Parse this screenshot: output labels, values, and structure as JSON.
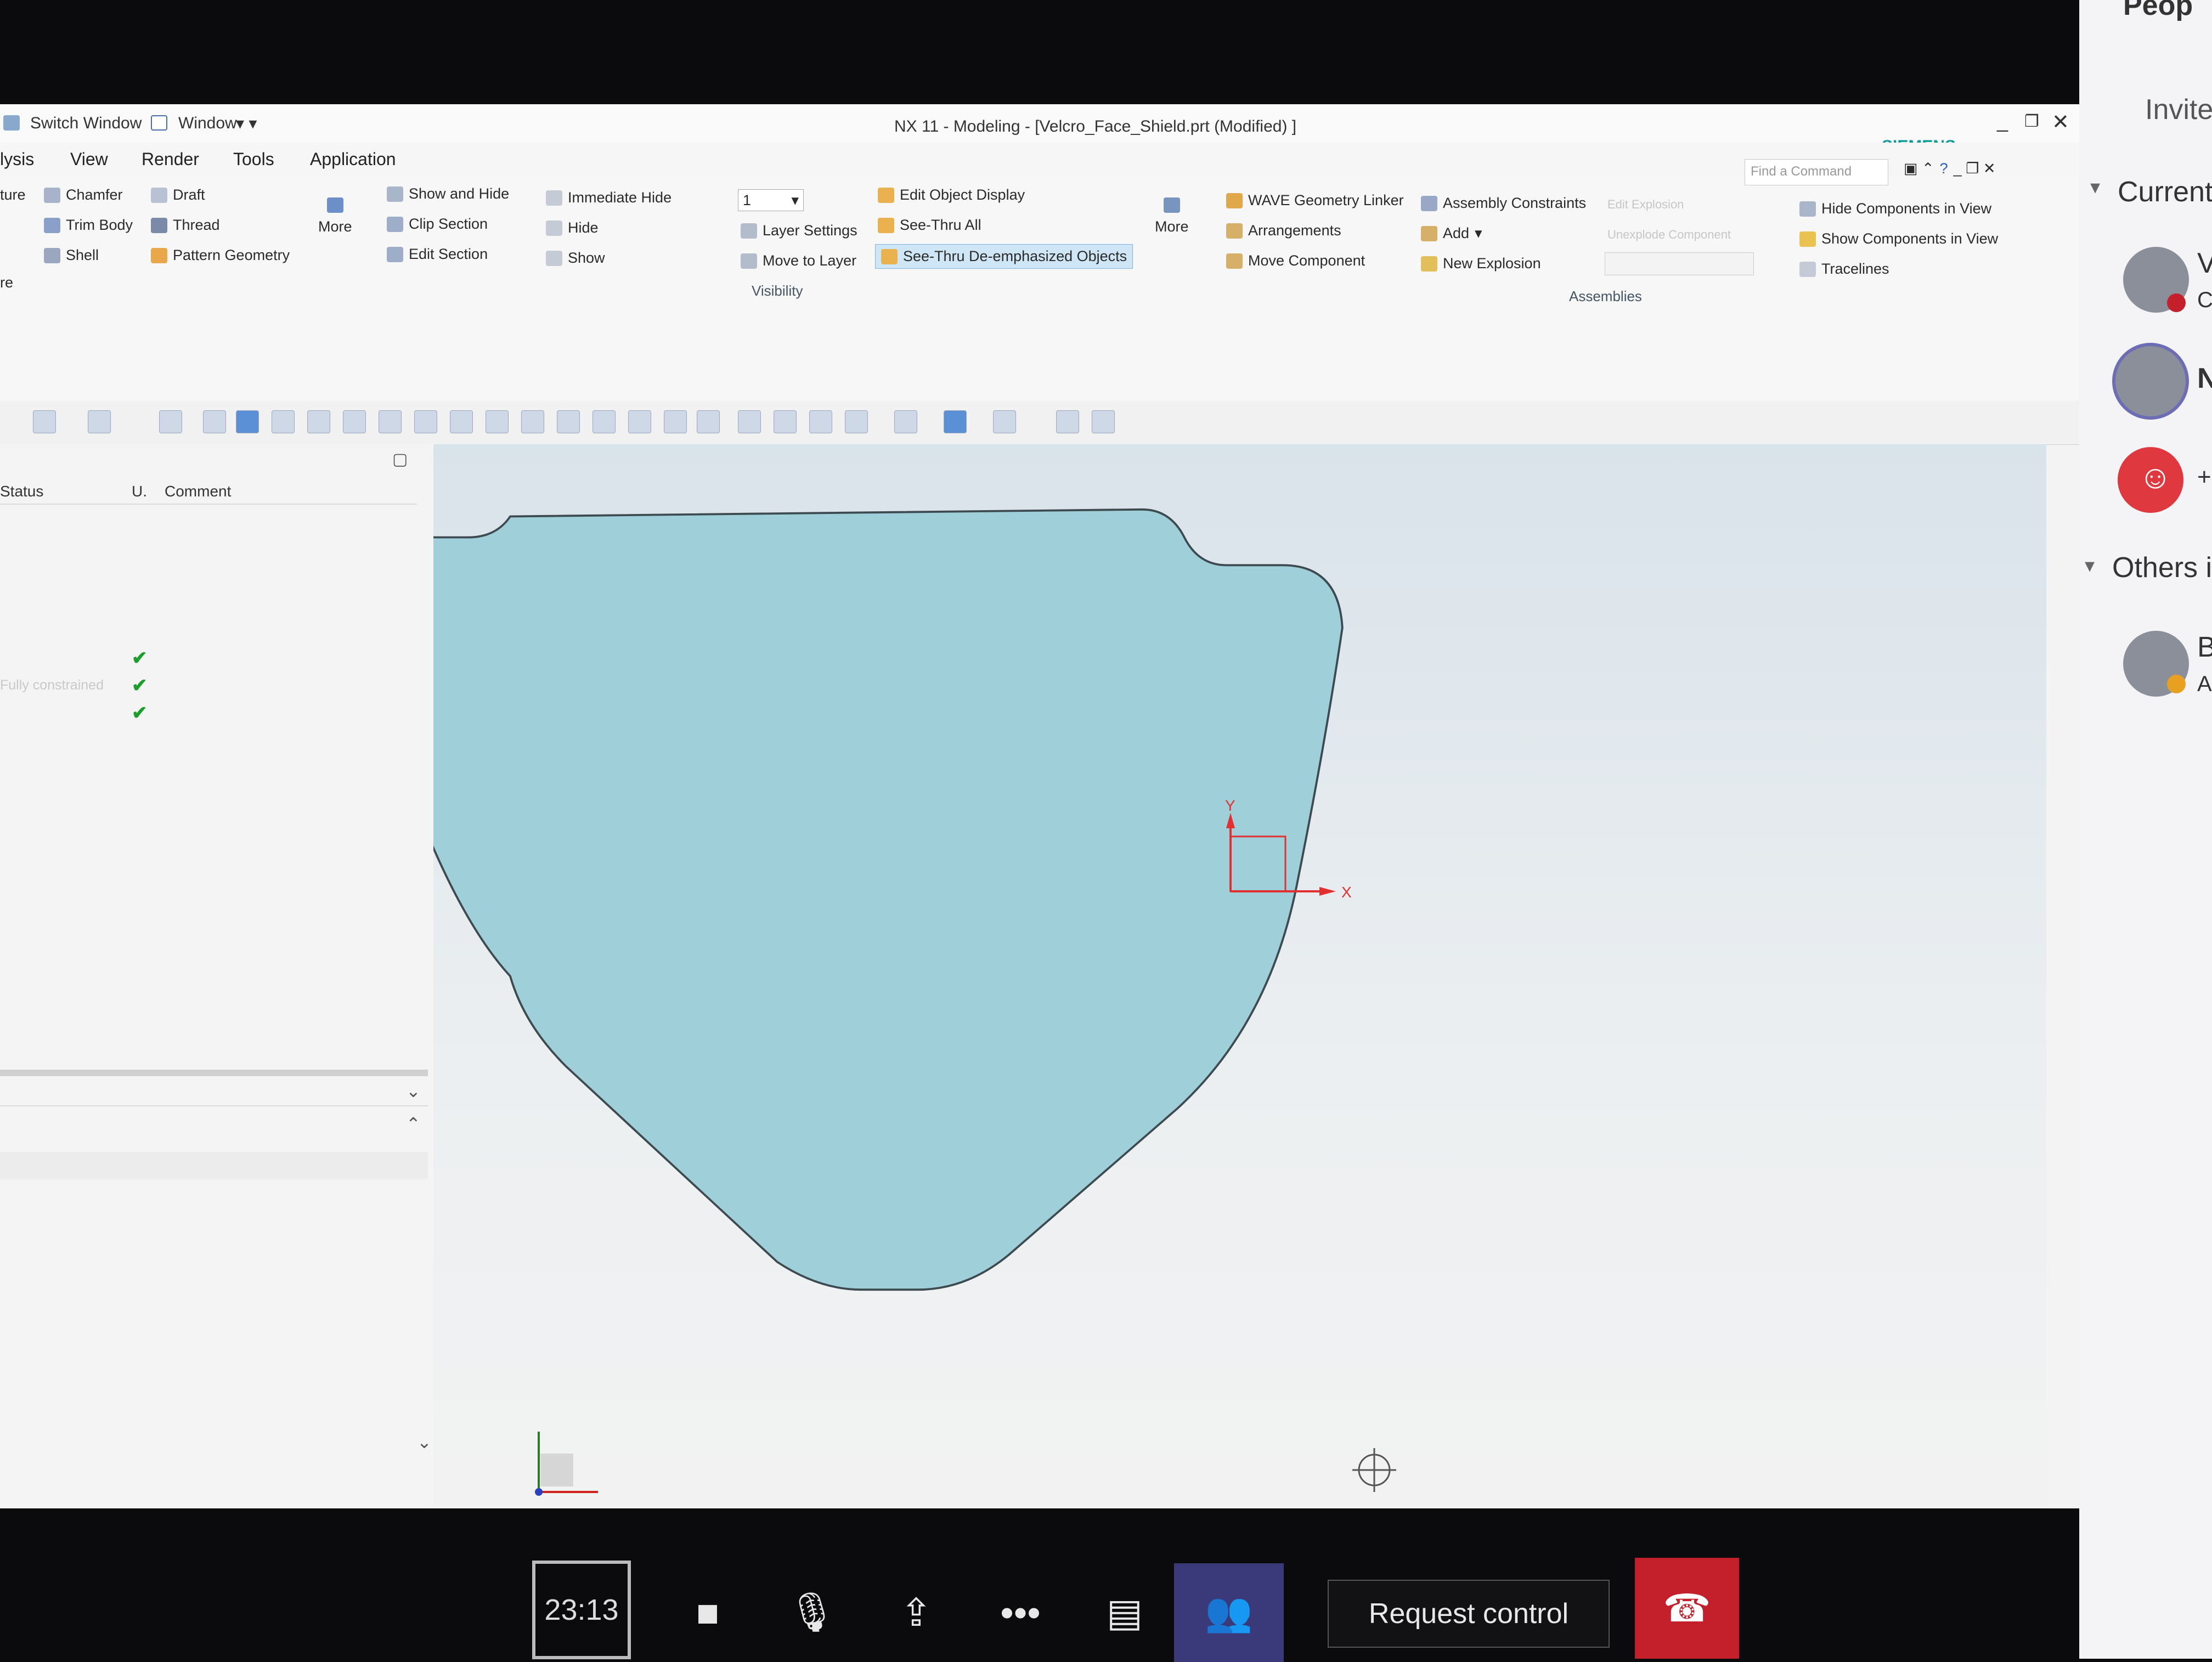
{
  "titlebar": {
    "switch_window": "Switch Window",
    "window_menu": "Window",
    "title": "NX 11 - Modeling - [Velcro_Face_Shield.prt (Modified) ]",
    "brand": "SIEMENS",
    "find_placeholder": "Find a Command"
  },
  "menu": {
    "items": [
      "lysis",
      "View",
      "Render",
      "Tools",
      "Application"
    ]
  },
  "ribbon": {
    "feature": {
      "items": [
        "ture",
        "Chamfer",
        "Draft",
        "Trim Body",
        "Thread",
        "Shell",
        "Pattern Geometry",
        "re"
      ],
      "more": "More"
    },
    "show_hide": {
      "items": [
        "Show and Hide",
        "Clip Section",
        "Edit Section",
        "Immediate Hide",
        "Hide",
        "Show"
      ]
    },
    "visibility": {
      "layer_value": "1",
      "items": [
        "Layer Settings",
        "Move to Layer",
        "Edit Object Display",
        "See-Thru All",
        "See-Thru De-emphasized Objects"
      ],
      "label": "Visibility",
      "more": "More"
    },
    "assemblies": {
      "items": [
        "WAVE Geometry Linker",
        "Arrangements",
        "Move Component",
        "Assembly Constraints",
        "Add",
        "New Explosion",
        "Edit Explosion",
        "Unexplode Component",
        "Hide Components in View",
        "Show Components in View",
        "Tracelines"
      ],
      "label": "Assemblies"
    }
  },
  "navigator": {
    "columns": [
      "Status",
      "U.",
      "Comment"
    ],
    "status_text": "Fully constrained"
  },
  "viewport": {
    "axis_x": "X",
    "axis_y": "Y"
  },
  "teams": {
    "header": "Peop",
    "invite": "Invite",
    "current": "Current",
    "others": "Others i",
    "p1_initial": "V",
    "p1_sub": "C",
    "p2_initial": "N",
    "p3_initial": "+",
    "p4_initial": "B",
    "p4_sub": "A"
  },
  "call": {
    "timer": "23:13",
    "request_control": "Request control"
  },
  "colors": {
    "shield_fill": "#9fcfd8",
    "accent": "#0a9a9a",
    "hangup": "#c4202b",
    "people_active": "#3a3a7a"
  }
}
